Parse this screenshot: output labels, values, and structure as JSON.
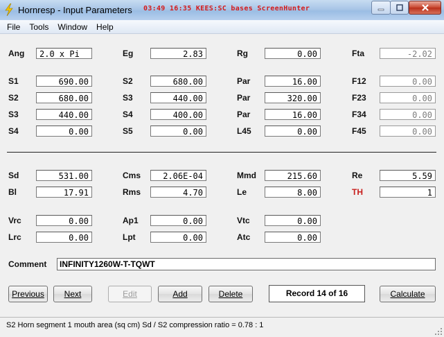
{
  "window": {
    "title": "Hornresp - Input Parameters",
    "overlay_text": "03:49  16:35  KEES:SC  bases  ScreenHunter",
    "controls": [
      "minimize",
      "maximize",
      "close"
    ]
  },
  "menu": [
    "File",
    "Tools",
    "Window",
    "Help"
  ],
  "fields": [
    {
      "label": "Ang",
      "value": "2.0 x Pi",
      "align": "left"
    },
    {
      "label": "Eg",
      "value": "2.83"
    },
    {
      "label": "Rg",
      "value": "0.00"
    },
    {
      "label": "Fta",
      "value": "-2.02",
      "disabled": true
    },
    {
      "label": "S1",
      "value": "690.00"
    },
    {
      "label": "S2",
      "value": "680.00"
    },
    {
      "label": "Par",
      "value": "16.00"
    },
    {
      "label": "F12",
      "value": "0.00",
      "disabled": true
    },
    {
      "label": "S2",
      "value": "680.00"
    },
    {
      "label": "S3",
      "value": "440.00"
    },
    {
      "label": "Par",
      "value": "320.00"
    },
    {
      "label": "F23",
      "value": "0.00",
      "disabled": true
    },
    {
      "label": "S3",
      "value": "440.00"
    },
    {
      "label": "S4",
      "value": "400.00"
    },
    {
      "label": "Par",
      "value": "16.00"
    },
    {
      "label": "F34",
      "value": "0.00",
      "disabled": true
    },
    {
      "label": "S4",
      "value": "0.00"
    },
    {
      "label": "S5",
      "value": "0.00"
    },
    {
      "label": "L45",
      "value": "0.00"
    },
    {
      "label": "F45",
      "value": "0.00",
      "disabled": true
    },
    {
      "label": "Sd",
      "value": "531.00"
    },
    {
      "label": "Cms",
      "value": "2.06E-04"
    },
    {
      "label": "Mmd",
      "value": "215.60"
    },
    {
      "label": "Re",
      "value": "5.59"
    },
    {
      "label": "Bl",
      "value": "17.91"
    },
    {
      "label": "Rms",
      "value": "4.70"
    },
    {
      "label": "Le",
      "value": "8.00"
    },
    {
      "label": "TH",
      "value": "1",
      "label_color": "#c8201e"
    },
    {
      "label": "Vrc",
      "value": "0.00"
    },
    {
      "label": "Ap1",
      "value": "0.00"
    },
    {
      "label": "Vtc",
      "value": "0.00"
    },
    {
      "label": "Lrc",
      "value": "0.00"
    },
    {
      "label": "Lpt",
      "value": "0.00"
    },
    {
      "label": "Atc",
      "value": "0.00"
    }
  ],
  "comment": {
    "label": "Comment",
    "value": "INFINITY1260W-T-TQWT"
  },
  "buttons": {
    "previous": "Previous",
    "next": "Next",
    "edit": "Edit",
    "add": "Add",
    "delete": "Delete",
    "calculate": "Calculate"
  },
  "record": "Record 14 of 16",
  "status": "S2   Horn segment 1 mouth area  (sq cm)    Sd / S2 compression ratio = 0.78 : 1"
}
